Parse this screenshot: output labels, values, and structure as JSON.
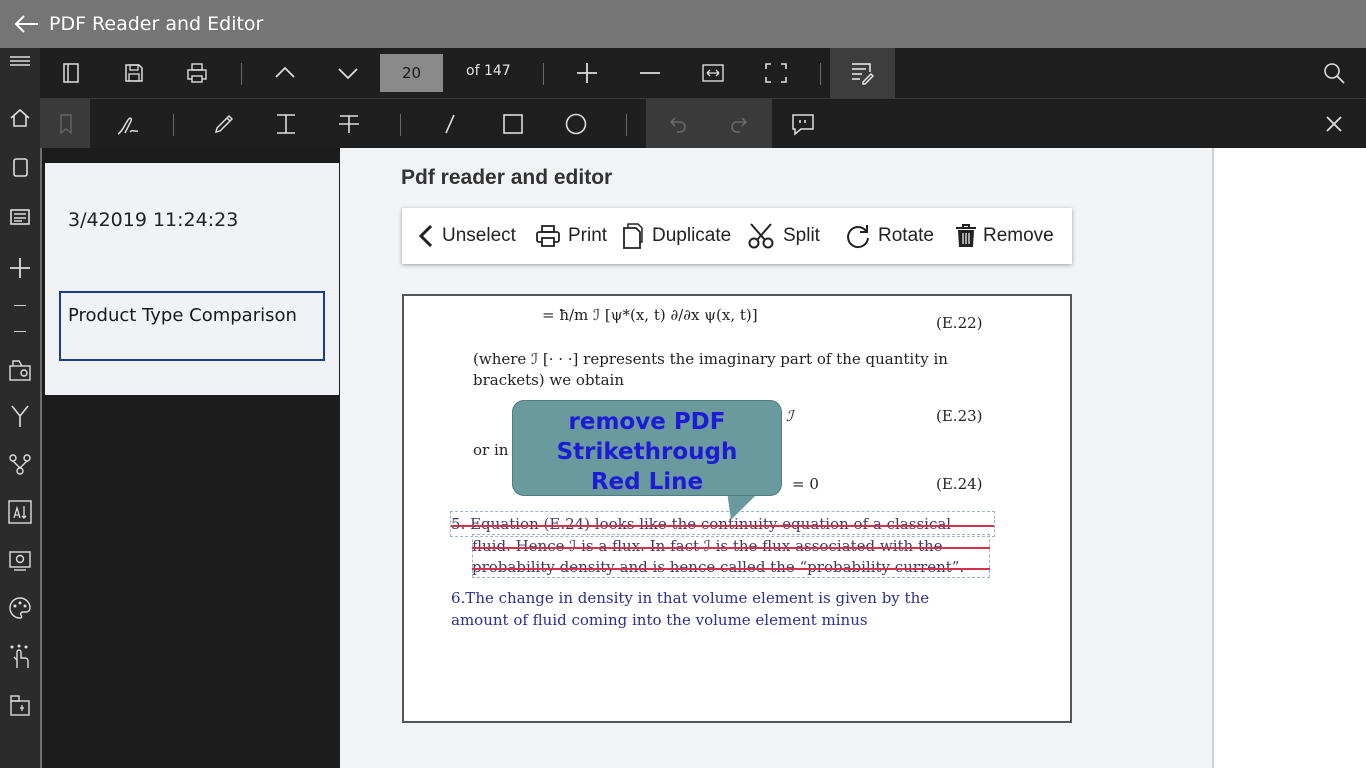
{
  "app": {
    "title": "PDF Reader and Editor"
  },
  "toolbar": {
    "page_number": "20",
    "page_of": "of 147"
  },
  "left_panel": {
    "timestamp": "3/42019 11:24:23",
    "item_label": "Product Type Comparison"
  },
  "main": {
    "heading": "Pdf reader and editor",
    "menu": {
      "unselect": "Unselect",
      "print": "Print",
      "duplicate": "Duplicate",
      "split": "Split",
      "rotate": "Rotate",
      "remove": "Remove"
    }
  },
  "document": {
    "eq22_lhs": "= ħ/m ℐ [ψ*(x, t) ∂/∂x ψ(x, t)]",
    "eq22_label": "(E.22)",
    "para1_line1": "(where ℐ [· · ·] represents the imaginary part of the quantity in",
    "para1_line2": "brackets) we obtain",
    "eq23_rhs": "ℐ",
    "eq23_label": "(E.23)",
    "or_in": "or in",
    "eq24_rhs": "= 0",
    "eq24_label": "(E.24)",
    "strike_line1": "5. Equation (E.24) looks like the continuity equation of a classical",
    "strike_line2": "fluid. Hence ℐ is a flux. In fact ℐ is the flux associated with the",
    "strike_line3": "probability density and is hence called the “probability current”.",
    "blue_line1": "6.The change in density in that volume element is given by the",
    "blue_line2": "amount of fluid coming into the volume element minus"
  },
  "callout": {
    "line1": "remove PDF",
    "line2": "Strikethrough",
    "line3": "Red Line"
  }
}
